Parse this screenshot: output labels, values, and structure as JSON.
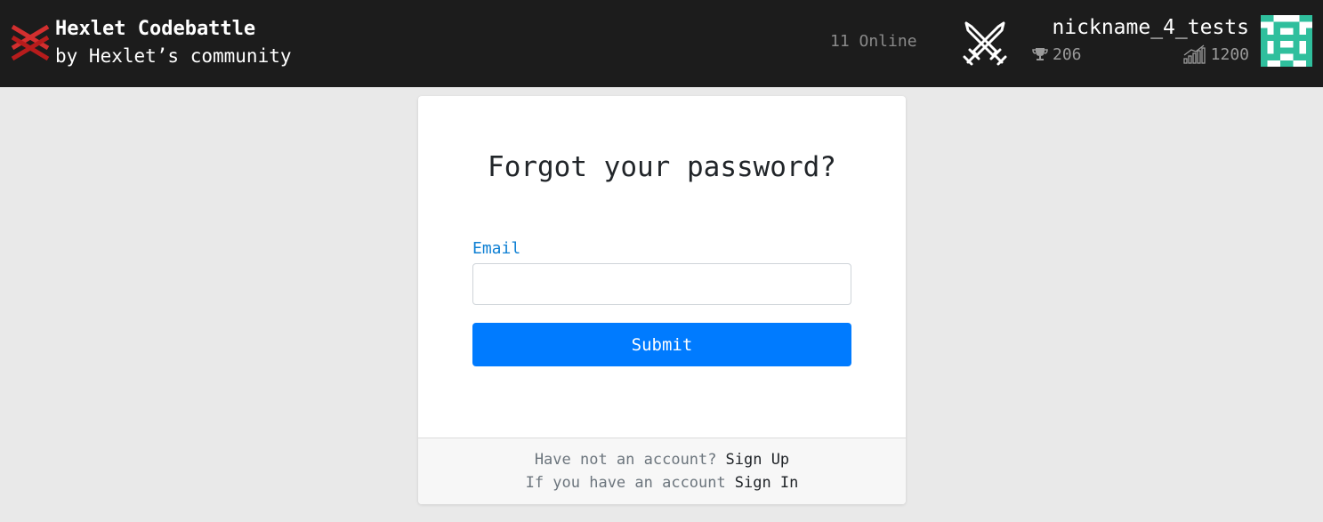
{
  "brand": {
    "title": "Hexlet Codebattle",
    "subtitle": "by Hexlet’s community",
    "logo_icon": "hexlet-x-logo",
    "logo_color": "#d32f2f"
  },
  "header": {
    "online_text": "11 Online",
    "battle_icon": "crossed-swords-icon",
    "user": {
      "nickname": "nickname_4_tests",
      "trophies": "206",
      "rating": "1200",
      "trophy_icon": "trophy-icon",
      "rating_icon": "bar-chart-icon",
      "avatar_color": "#2fbf9d"
    }
  },
  "card": {
    "title": "Forgot your password?",
    "email_label": "Email",
    "email_value": "",
    "email_placeholder": "",
    "submit_label": "Submit",
    "footer": {
      "no_account_text": "Have not an account?",
      "sign_up_label": "Sign Up",
      "have_account_text": "If you have an account",
      "sign_in_label": "Sign In"
    }
  },
  "colors": {
    "navbar_bg": "#1c1c1c",
    "page_bg": "#e9e9e9",
    "primary": "#007bff",
    "label_blue": "#0d7fd3"
  }
}
